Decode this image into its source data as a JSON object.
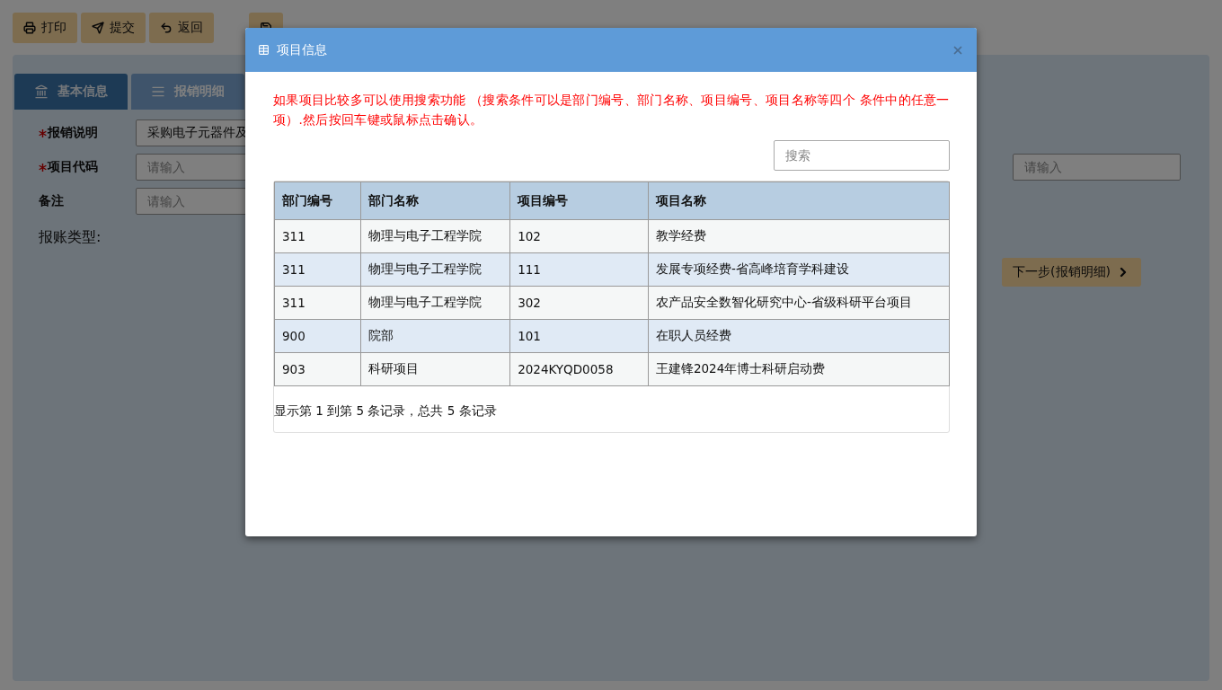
{
  "toolbar": {
    "buttons": [
      {
        "kind": "print",
        "label": "打印"
      },
      {
        "kind": "send",
        "label": "提交"
      },
      {
        "kind": "back",
        "label": "返回"
      },
      {
        "kind": "save"
      }
    ]
  },
  "form": {
    "tabs": [
      {
        "kind": "bank",
        "label": "基本信息",
        "selected": true
      },
      {
        "kind": "list",
        "label": "报销明细",
        "selected": false
      }
    ],
    "fields": [
      {
        "label": "报销说明",
        "required": true,
        "value": "采购电子元器件及"
      },
      {
        "label": "项目代码",
        "required": true,
        "placeholder": "请输入"
      },
      {
        "label": "备注",
        "required": false,
        "placeholder": "请输入"
      }
    ],
    "side_field": {
      "placeholder": "请输入"
    },
    "type_label": "报账类型:",
    "next_button": "下一步(报销明细)"
  },
  "modal": {
    "title": "项目信息",
    "notice": "如果项目比较多可以使用搜索功能 （搜索条件可以是部门编号、部门名称、项目编号、项目名称等四个 条件中的任意一项）.然后按回车键或鼠标点击确认。",
    "search": {
      "placeholder": "搜索"
    },
    "table": {
      "columns": [
        "部门编号",
        "部门名称",
        "项目编号",
        "项目名称"
      ],
      "rows": [
        [
          "311",
          "物理与电子工程学院",
          "102",
          "教学经费"
        ],
        [
          "311",
          "物理与电子工程学院",
          "111",
          "发展专项经费-省高峰培育学科建设"
        ],
        [
          "311",
          "物理与电子工程学院",
          "302",
          "农产品安全数智化研究中心-省级科研平台项目"
        ],
        [
          "900",
          "院部",
          "101",
          "在职人员经费"
        ],
        [
          "903",
          "科研项目",
          "2024KYQD0058",
          "王建锋2024年博士科研启动费"
        ]
      ]
    },
    "footer": "显示第 1 到第 5 条记录，总共 5 条记录"
  }
}
